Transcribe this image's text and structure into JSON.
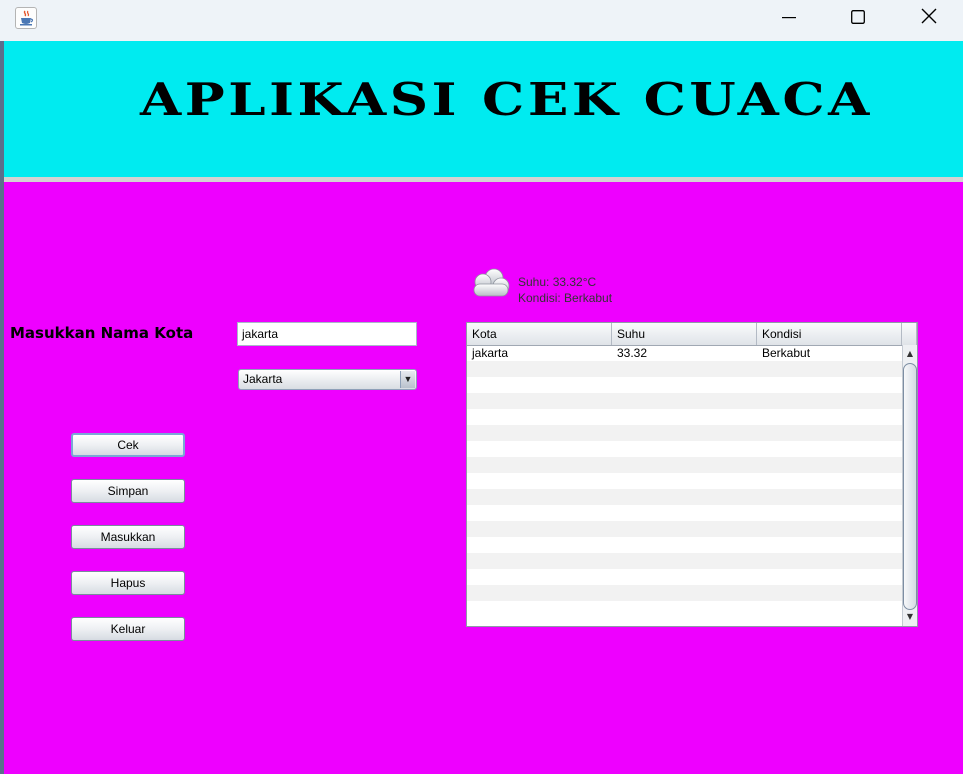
{
  "window": {
    "app_icon": "java-cup-icon",
    "controls": [
      "minimize-icon",
      "maximize-icon",
      "close-icon"
    ]
  },
  "header": {
    "title": "APLIKASI CEK CUACA",
    "background": "#00ebf0"
  },
  "main": {
    "background": "#ee00ff",
    "city_label": "Masukkan Nama Kota",
    "city_input_value": "jakarta",
    "city_select_value": "Jakarta",
    "buttons": {
      "cek": "Cek",
      "simpan": "Simpan",
      "masukkan": "Masukkan",
      "hapus": "Hapus",
      "keluar": "Keluar"
    },
    "weather": {
      "icon": "cloud-icon",
      "suhu": "Suhu: 33.32°C",
      "kondisi": "Kondisi: Berkabut"
    },
    "table": {
      "columns": [
        "Kota",
        "Suhu",
        "Kondisi"
      ],
      "rows": [
        [
          "jakarta",
          "33.32",
          "Berkabut"
        ]
      ]
    }
  }
}
